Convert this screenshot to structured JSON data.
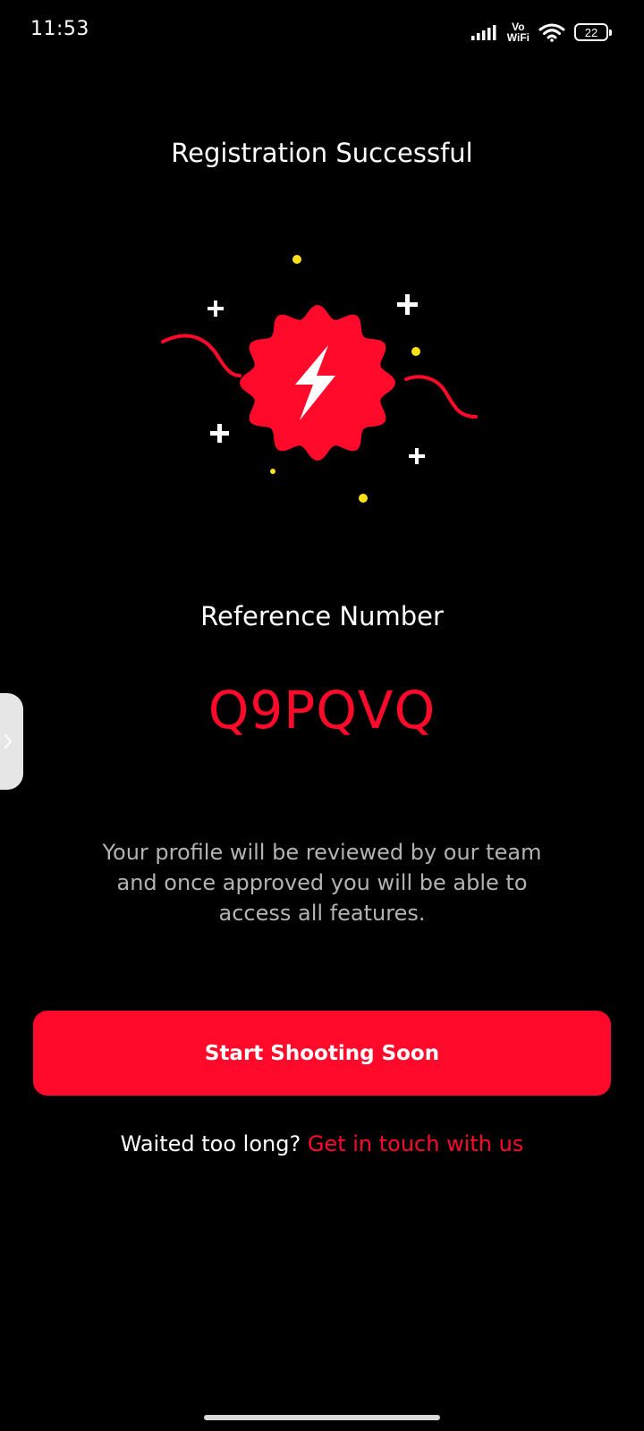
{
  "status_bar": {
    "time": "11:53",
    "network_label_top": "Vo",
    "network_label_bottom": "WiFi",
    "battery_level": "22",
    "icons": [
      "signal-icon",
      "wifi-icon",
      "battery-icon"
    ]
  },
  "header": {
    "title": "Registration Successful"
  },
  "illustration": {
    "icon": "lightning-badge-icon",
    "accent_color": "#ff0a2a",
    "sparkle_color": "#ffffff",
    "dot_color": "#ffe11a"
  },
  "reference": {
    "label": "Reference Number",
    "value": "Q9PQVQ"
  },
  "description": "Your profile will be reviewed by our team and once approved you will be able to access all features.",
  "primary_button": {
    "label": "Start Shooting Soon"
  },
  "footer": {
    "prompt": "Waited too long? ",
    "link_label": "Get in touch with us"
  },
  "side_handle": {
    "icon": "chevron-right-icon"
  },
  "colors": {
    "background": "#000000",
    "accent": "#ff0a2a",
    "muted_text": "#b3b3b3"
  }
}
